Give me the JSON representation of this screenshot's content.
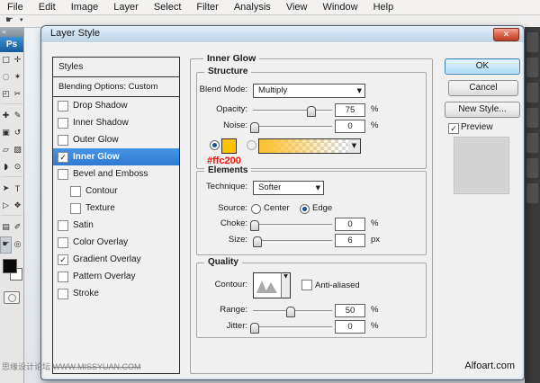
{
  "icons": {
    "close": "✕",
    "dropdown": "▼",
    "check": "✓",
    "collapse": "«",
    "tool_arrow": "▾",
    "options_hand": "☛"
  },
  "menu": {
    "items": [
      "File",
      "Edit",
      "Image",
      "Layer",
      "Select",
      "Filter",
      "Analysis",
      "View",
      "Window",
      "Help"
    ]
  },
  "toolbar": {
    "logo": "Ps",
    "fg_color": "#0a0a0a",
    "bg_color": "#ffffff",
    "tools": [
      {
        "name": "rectangular-marquee-tool",
        "glyph": "□"
      },
      {
        "name": "move-tool",
        "glyph": "✛"
      },
      {
        "name": "lasso-tool",
        "glyph": "◌"
      },
      {
        "name": "magic-wand-tool",
        "glyph": "✶"
      },
      {
        "name": "crop-tool",
        "glyph": "◰"
      },
      {
        "name": "slice-tool",
        "glyph": "✂"
      },
      {
        "name": "healing-brush-tool",
        "glyph": "✚"
      },
      {
        "name": "brush-tool",
        "glyph": "✎"
      },
      {
        "name": "clone-stamp-tool",
        "glyph": "▣"
      },
      {
        "name": "history-brush-tool",
        "glyph": "↺"
      },
      {
        "name": "eraser-tool",
        "glyph": "▱"
      },
      {
        "name": "gradient-tool",
        "glyph": "▨"
      },
      {
        "name": "blur-tool",
        "glyph": "◗"
      },
      {
        "name": "dodge-tool",
        "glyph": "⊙"
      },
      {
        "name": "path-selection-tool",
        "glyph": "➤"
      },
      {
        "name": "type-tool",
        "glyph": "T"
      },
      {
        "name": "direct-selection-tool",
        "glyph": "▷"
      },
      {
        "name": "custom-shape-tool",
        "glyph": "❖"
      },
      {
        "name": "notes-tool",
        "glyph": "▤"
      },
      {
        "name": "eyedropper-tool",
        "glyph": "✐"
      },
      {
        "name": "hand-tool",
        "glyph": "☛"
      },
      {
        "name": "zoom-tool",
        "glyph": "◎"
      }
    ]
  },
  "dialog": {
    "title": "Layer Style",
    "styles_panel": {
      "header": "Styles",
      "blending_options": "Blending Options: Custom",
      "items": [
        {
          "label": "Drop Shadow",
          "checked": false,
          "selected": false
        },
        {
          "label": "Inner Shadow",
          "checked": false,
          "selected": false
        },
        {
          "label": "Outer Glow",
          "checked": false,
          "selected": false
        },
        {
          "label": "Inner Glow",
          "checked": true,
          "selected": true
        },
        {
          "label": "Bevel and Emboss",
          "checked": false,
          "selected": false
        },
        {
          "label": "Contour",
          "checked": false,
          "selected": false,
          "indent": true
        },
        {
          "label": "Texture",
          "checked": false,
          "selected": false,
          "indent": true
        },
        {
          "label": "Satin",
          "checked": false,
          "selected": false
        },
        {
          "label": "Color Overlay",
          "checked": false,
          "selected": false
        },
        {
          "label": "Gradient Overlay",
          "checked": true,
          "selected": false
        },
        {
          "label": "Pattern Overlay",
          "checked": false,
          "selected": false
        },
        {
          "label": "Stroke",
          "checked": false,
          "selected": false
        }
      ]
    },
    "panel_title": "Inner Glow",
    "structure": {
      "legend": "Structure",
      "blend_mode_label": "Blend Mode:",
      "blend_mode_value": "Multiply",
      "opacity_label": "Opacity:",
      "opacity_value": "75",
      "opacity_unit": "%",
      "noise_label": "Noise:",
      "noise_value": "0",
      "noise_unit": "%",
      "swatch_color": "#ffc200",
      "annotation_text": "#ffc200",
      "annotation_color": "#ee1208"
    },
    "elements": {
      "legend": "Elements",
      "technique_label": "Technique:",
      "technique_value": "Softer",
      "source_label": "Source:",
      "source_center": "Center",
      "source_edge": "Edge",
      "choke_label": "Choke:",
      "choke_value": "0",
      "choke_unit": "%",
      "size_label": "Size:",
      "size_value": "6",
      "size_unit": "px"
    },
    "quality": {
      "legend": "Quality",
      "contour_label": "Contour:",
      "antialiased_label": "Anti-aliased",
      "range_label": "Range:",
      "range_value": "50",
      "range_unit": "%",
      "jitter_label": "Jitter:",
      "jitter_value": "0",
      "jitter_unit": "%"
    },
    "buttons": {
      "ok": "OK",
      "cancel": "Cancel",
      "new_style": "New Style...",
      "preview": "Preview"
    },
    "credit": "Alfoart.com"
  },
  "sliders": {
    "opacity": 73,
    "noise": 1,
    "choke": 1,
    "size": 5,
    "range": 47,
    "jitter": 1
  },
  "watermark": {
    "cjk": "思缘设计论坛",
    "url": "WWW.MISSYUAN.COM"
  }
}
